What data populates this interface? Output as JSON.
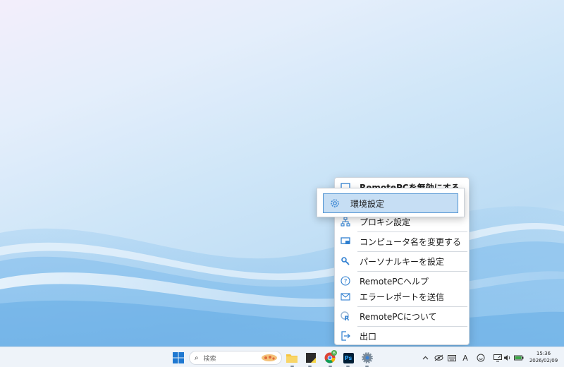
{
  "menu": {
    "items": [
      {
        "label": "RemotePCを無効にする",
        "icon": "monitor-icon"
      },
      {
        "label": "プロキシ設定",
        "icon": "network-icon"
      },
      {
        "label": "コンピュータ名を変更する",
        "icon": "rename-computer-icon"
      },
      {
        "label": "パーソナルキーを設定",
        "icon": "key-icon"
      },
      {
        "label": "RemotePCヘルプ",
        "icon": "help-icon"
      },
      {
        "label": "エラーレポートを送信",
        "icon": "mail-icon"
      },
      {
        "label": "RemotePCについて",
        "icon": "remotepc-logo-icon"
      },
      {
        "label": "出口",
        "icon": "exit-icon"
      }
    ]
  },
  "popup": {
    "highlighted_label": "環境設定",
    "icon": "gear-icon"
  },
  "taskbar": {
    "search_placeholder": "検索",
    "photoshop_label": "Ps",
    "chrome_badge": "6",
    "keyboard_indicator": "A",
    "clock_time": "15:36",
    "clock_date": "2026/02/09"
  },
  "colors": {
    "highlight_bg": "#c6def4",
    "highlight_border": "#4f93d2",
    "accent_blue": "#2f7fd0"
  }
}
